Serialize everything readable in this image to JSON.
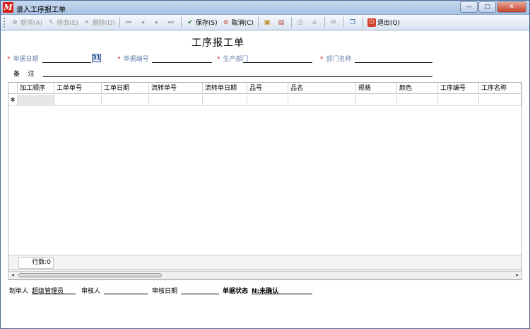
{
  "window": {
    "title": "录入工序报工单",
    "app_icon": "M",
    "controls": {
      "minimize": "—",
      "maximize": "□",
      "close": "✕"
    }
  },
  "toolbar": {
    "add": "新增(A)",
    "edit": "修改(E)",
    "delete": "删除(D)",
    "save": "保存(S)",
    "cancel": "取消(C)",
    "exit": "退出(Q)"
  },
  "form": {
    "title": "工序报工单",
    "required_mark": "*",
    "fields": {
      "bill_date": "单据日期",
      "bill_no": "单据编号",
      "production_dept": "生产部门",
      "dept_name": "部门名称",
      "remark": "备    注"
    },
    "calendar_label": "31"
  },
  "grid": {
    "columns": [
      "加工顺序",
      "工单单号",
      "工单日期",
      "流转单号",
      "流转单日期",
      "品号",
      "品名",
      "规格",
      "颜色",
      "工序编号",
      "工序名称"
    ],
    "new_row_marker": "✱",
    "row_count": "行数:0"
  },
  "footer": {
    "creator_label": "制单人",
    "creator_value": "超级管理员",
    "reviewer_label": "审核人",
    "review_date_label": "审核日期",
    "status_label": "单据状态",
    "status_value": "N:未确认"
  },
  "colors": {
    "required": "#d0191a",
    "label": "#6b86b0",
    "titlebar": "#b7cde9"
  }
}
